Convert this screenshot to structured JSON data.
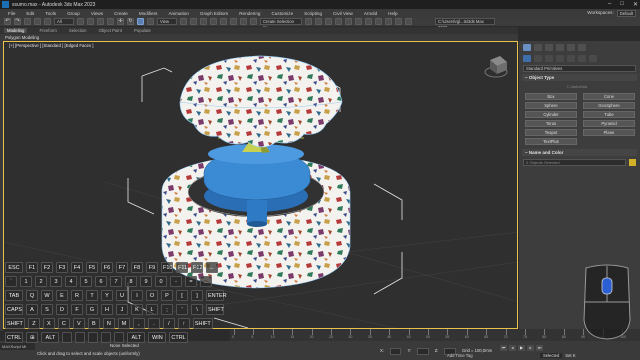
{
  "titlebar": {
    "title": "ssumo.max - Autodesk 3ds Max 2023",
    "controls": [
      "–",
      "□",
      "✕"
    ]
  },
  "menubar": {
    "items": [
      "File",
      "Edit",
      "Tools",
      "Group",
      "Views",
      "Create",
      "Modifiers",
      "Animation",
      "Graph Editors",
      "Rendering",
      "Customize",
      "Scripting",
      "Civil View",
      "Arnold",
      "Help"
    ],
    "workspaces_label": "Workspaces:",
    "workspace_value": "Default"
  },
  "toolbar": {
    "filter_value": "All",
    "view_value": "View",
    "selection_set": "Create Selection Se",
    "path": "C:\\Users\\rgl...ts\\3ds Max 2023"
  },
  "ribbon": {
    "tabs": [
      "Modeling",
      "Freeform",
      "Selection",
      "Object Paint",
      "Populate"
    ],
    "sub": "Polygon Modeling"
  },
  "viewport": {
    "label": "[+] [Perspective ] [Standard ] [Edged Faces ]"
  },
  "command_panel": {
    "category": "Standard Primitives",
    "object_type_title": "Object Type",
    "autogrid": "AutoGrid",
    "objects": [
      "Box",
      "Cone",
      "Sphere",
      "GeoSphere",
      "Cylinder",
      "Tube",
      "Torus",
      "Pyramid",
      "Teapot",
      "Plane",
      "TextPlus"
    ],
    "name_color_title": "Name and Color",
    "name_placeholder": "0 Objects Selected"
  },
  "timeline": {
    "ticks": [
      "0",
      "5",
      "10",
      "15",
      "20",
      "25",
      "30",
      "35",
      "40",
      "45",
      "50",
      "55",
      "60",
      "65",
      "70",
      "75",
      "80",
      "85",
      "90",
      "95",
      "100"
    ]
  },
  "status": {
    "maxscript": "MAXScript Mi",
    "selection": "None Selected",
    "prompt": "Click and drag to select and scale objects (uniformly)",
    "x": "X:",
    "y": "Y:",
    "z": "Z:",
    "grid": "Grid = 100,0mm",
    "addtime": "Add Time Tag",
    "selected": "Selected",
    "set_key": "Set K"
  },
  "keyboard": {
    "rows": [
      [
        "ESC",
        "F1",
        "F2",
        "F3",
        "F4",
        "F5",
        "F6",
        "F7",
        "F8",
        "F9",
        "F10",
        "F11",
        "F12",
        "←"
      ],
      [
        "`",
        "1",
        "2",
        "3",
        "4",
        "5",
        "6",
        "7",
        "8",
        "9",
        "0",
        "-",
        "=",
        "←"
      ],
      [
        "TAB",
        "Q",
        "W",
        "E",
        "R",
        "T",
        "Y",
        "U",
        "I",
        "O",
        "P",
        "[",
        "]",
        "ENTER"
      ],
      [
        "CAPS",
        "A",
        "S",
        "D",
        "F",
        "G",
        "H",
        "J",
        "K",
        "L",
        ";",
        "'",
        "\\",
        "SHIFT"
      ],
      [
        "SHIFT",
        "Z",
        "X",
        "C",
        "V",
        "B",
        "N",
        "M",
        ",",
        ".",
        "/",
        "↑",
        "SHIFT"
      ],
      [
        "CTRL",
        "⊞",
        "ALT",
        "",
        "",
        "",
        "",
        "",
        "ALT",
        "WIN",
        "CTRL"
      ]
    ]
  },
  "colors": {
    "accent": "#e8c24a",
    "selection_blue": "#3b82c4",
    "panel": "#3d3d3d"
  }
}
